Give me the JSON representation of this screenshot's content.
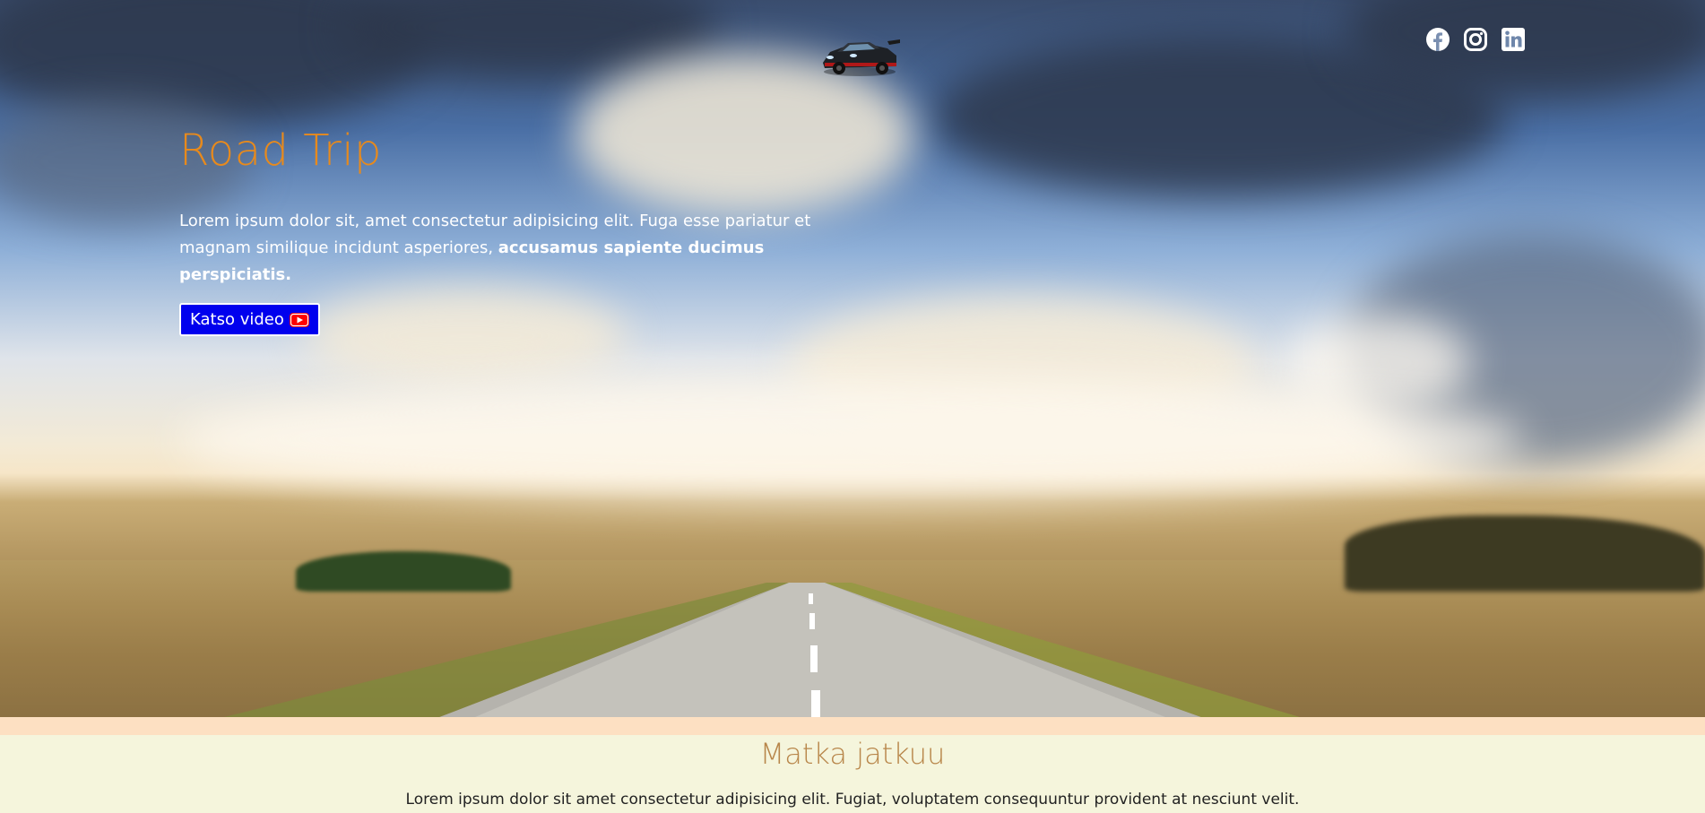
{
  "hero": {
    "title": "Road Trip",
    "text_plain": "Lorem ipsum dolor sit, amet consectetur adipisicing elit. Fuga esse pariatur et magnam similique incidunt asperiores, ",
    "text_bold": "accusamus sapiente ducimus perspiciatis.",
    "video_button_label": "Katso video",
    "video_button_icon": "youtube-icon"
  },
  "header": {
    "logo_icon": "car-logo-icon",
    "social": [
      {
        "name": "facebook-icon"
      },
      {
        "name": "instagram-icon"
      },
      {
        "name": "linkedin-icon"
      }
    ]
  },
  "section": {
    "title": "Matka jatkuu",
    "text": "Lorem ipsum dolor sit amet consectetur adipisicing elit. Fugiat, voluptatem consequuntur provident at nesciunt velit."
  },
  "colors": {
    "title_orange": "#e88a1c",
    "button_blue": "#0000ee",
    "section_bg": "#f5f5dc",
    "band_peach": "#fde0c2",
    "section_title": "#b8864a"
  }
}
